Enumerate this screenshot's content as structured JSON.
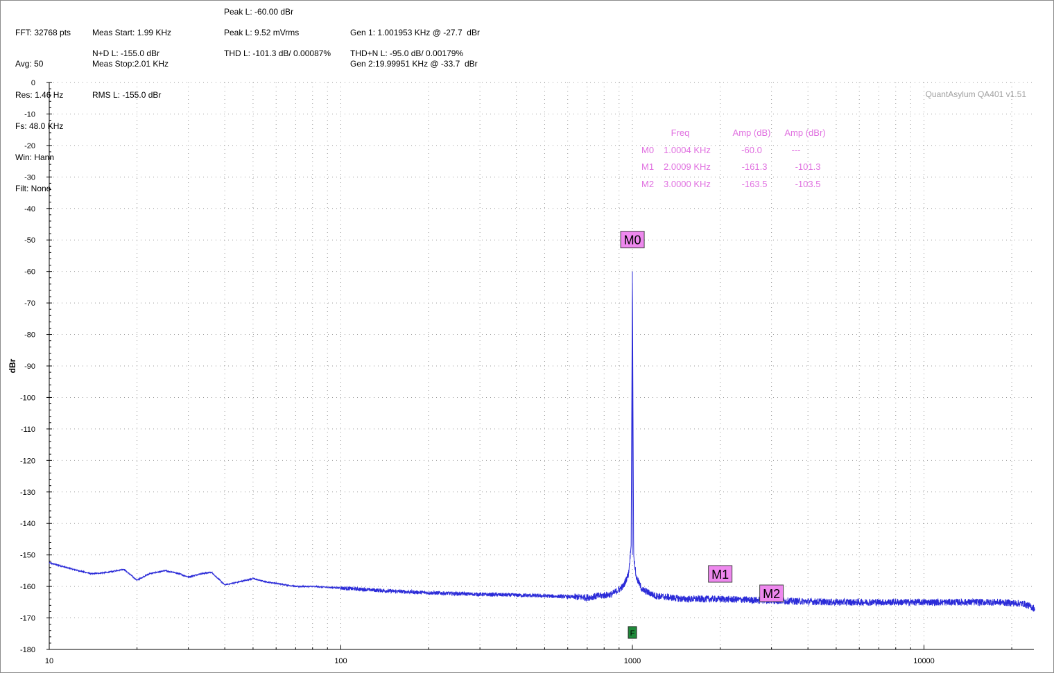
{
  "header": {
    "col1": [
      "FFT: 32768 pts",
      "Avg: 50",
      "Res: 1.46 Hz",
      "Fs: 48.0 KHz",
      "Win: Hann",
      "Filt: None"
    ],
    "meas_start": "Meas Start: 1.99 KHz",
    "meas_stop": "Meas Stop:2.01 KHz",
    "rms": "RMS L: -155.0 dBr",
    "nd": "N+D L: -155.0 dBr",
    "peak_dbr": "Peak L: -60.00 dBr",
    "peak_mv": "Peak L: 9.52 mVrms",
    "thd": "THD L: -101.3 dB/ 0.00087%",
    "gen1": "Gen 1: 1.001953 KHz @ -27.7  dBr",
    "gen2": "Gen 2:19.99951 KHz @ -33.7  dBr",
    "thdn": "THD+N L: -95.0 dB/ 0.00179%"
  },
  "brand": "QuantAsylum QA401 v1.51",
  "marker_table": {
    "headers": [
      "Freq",
      "Amp (dB)",
      "Amp (dBr)"
    ],
    "rows": [
      {
        "name": "M0",
        "freq": "1.0004 KHz",
        "amp_db": "-60.0",
        "amp_dbr": "---"
      },
      {
        "name": "M1",
        "freq": "2.0009 KHz",
        "amp_db": "-161.3",
        "amp_dbr": "-101.3"
      },
      {
        "name": "M2",
        "freq": "3.0000 KHz",
        "amp_db": "-163.5",
        "amp_dbr": "-103.5"
      }
    ]
  },
  "colors": {
    "trace": "#2b2bd8",
    "marker_label_bg": "#ee88ee",
    "marker_text": "#e070e0",
    "f_marker_bg": "#1f8a3a",
    "grid": "#9a9a9a"
  },
  "chart_data": {
    "type": "line",
    "xscale": "log",
    "xlim": [
      10,
      24000
    ],
    "ylim": [
      -180,
      0
    ],
    "ylabel": "dBr",
    "xticks": [
      10,
      100,
      1000,
      10000
    ],
    "xtick_labels": [
      "10",
      "100",
      "1000",
      "10000"
    ],
    "yticks": [
      0,
      -10,
      -20,
      -30,
      -40,
      -50,
      -60,
      -70,
      -80,
      -90,
      -100,
      -110,
      -120,
      -130,
      -140,
      -150,
      -160,
      -170,
      -180
    ],
    "grid": true,
    "series": [
      {
        "x": [
          10,
          12,
          14,
          16,
          18,
          20,
          22,
          25,
          28,
          30,
          33,
          36,
          40,
          45,
          50,
          55,
          60,
          70,
          80,
          100,
          150,
          200,
          300,
          500,
          700,
          850,
          930,
          970,
          990,
          1000,
          1010,
          1030,
          1080,
          1200,
          1500,
          2000,
          3000,
          5000,
          8000,
          12000,
          18000,
          22000,
          24000
        ],
        "y": [
          -152.5,
          -154.5,
          -156,
          -155.5,
          -154.5,
          -158,
          -156,
          -155,
          -156,
          -157,
          -156,
          -155.5,
          -159.5,
          -158.5,
          -157.5,
          -158.5,
          -159,
          -160,
          -160,
          -160.5,
          -161.5,
          -162,
          -162.5,
          -163,
          -163.5,
          -162.5,
          -160,
          -156,
          -147,
          -60,
          -150,
          -157,
          -161,
          -163,
          -164,
          -164,
          -164.5,
          -165,
          -165,
          -165,
          -165,
          -165.5,
          -167
        ]
      }
    ],
    "markers": [
      {
        "label": "M0",
        "x": 1000.4,
        "y": -60.0
      },
      {
        "label": "M1",
        "x": 2000.9,
        "y": -161.3
      },
      {
        "label": "M2",
        "x": 3000.0,
        "y": -163.5
      }
    ],
    "f_marker": {
      "label": "F",
      "x": 1000
    }
  }
}
